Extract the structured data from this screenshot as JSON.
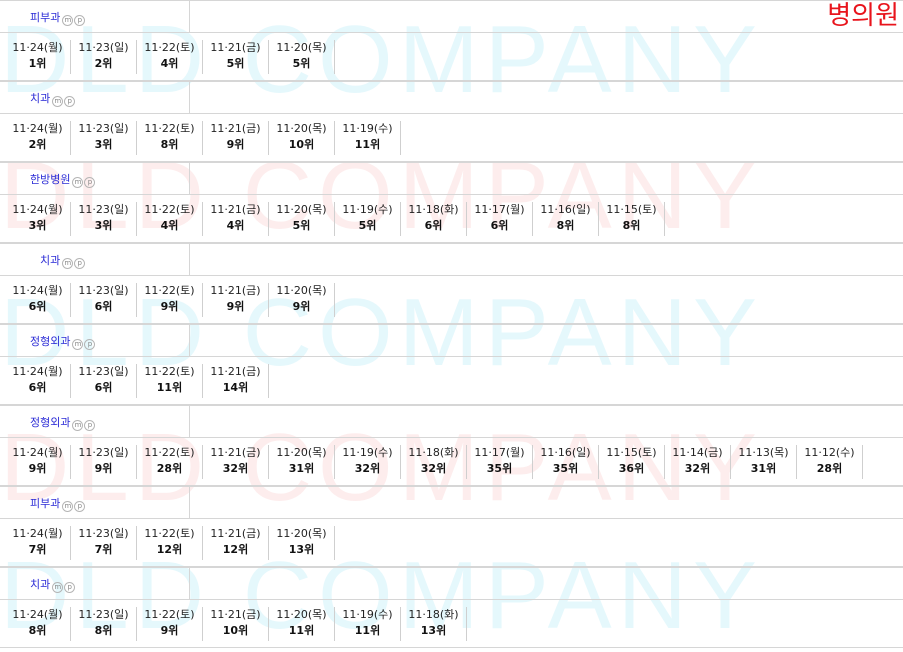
{
  "brand": "병의원",
  "watermark": "DLD COMPANY",
  "mp_icons": [
    "m",
    "p"
  ],
  "sections": [
    {
      "dept": "피부과",
      "ranks": [
        {
          "d": "11·24(월)",
          "r": "1위"
        },
        {
          "d": "11·23(일)",
          "r": "2위"
        },
        {
          "d": "11·22(토)",
          "r": "4위"
        },
        {
          "d": "11·21(금)",
          "r": "5위"
        },
        {
          "d": "11·20(목)",
          "r": "5위"
        }
      ]
    },
    {
      "dept": "치과",
      "ranks": [
        {
          "d": "11·24(월)",
          "r": "2위"
        },
        {
          "d": "11·23(일)",
          "r": "3위"
        },
        {
          "d": "11·22(토)",
          "r": "8위"
        },
        {
          "d": "11·21(금)",
          "r": "9위"
        },
        {
          "d": "11·20(목)",
          "r": "10위"
        },
        {
          "d": "11·19(수)",
          "r": "11위"
        }
      ]
    },
    {
      "dept": "한방병원",
      "ranks": [
        {
          "d": "11·24(월)",
          "r": "3위"
        },
        {
          "d": "11·23(일)",
          "r": "3위"
        },
        {
          "d": "11·22(토)",
          "r": "4위"
        },
        {
          "d": "11·21(금)",
          "r": "4위"
        },
        {
          "d": "11·20(목)",
          "r": "5위"
        },
        {
          "d": "11·19(수)",
          "r": "5위"
        },
        {
          "d": "11·18(화)",
          "r": "6위"
        },
        {
          "d": "11·17(월)",
          "r": "6위"
        },
        {
          "d": "11·16(일)",
          "r": "8위"
        },
        {
          "d": "11·15(토)",
          "r": "8위"
        }
      ]
    },
    {
      "dept": "치과",
      "ranks": [
        {
          "d": "11·24(월)",
          "r": "6위"
        },
        {
          "d": "11·23(일)",
          "r": "6위"
        },
        {
          "d": "11·22(토)",
          "r": "9위"
        },
        {
          "d": "11·21(금)",
          "r": "9위"
        },
        {
          "d": "11·20(목)",
          "r": "9위"
        }
      ]
    },
    {
      "dept": "정형외과",
      "ranks": [
        {
          "d": "11·24(월)",
          "r": "6위"
        },
        {
          "d": "11·23(일)",
          "r": "6위"
        },
        {
          "d": "11·22(토)",
          "r": "11위"
        },
        {
          "d": "11·21(금)",
          "r": "14위"
        }
      ]
    },
    {
      "dept": "정형외과",
      "ranks": [
        {
          "d": "11·24(월)",
          "r": "9위"
        },
        {
          "d": "11·23(일)",
          "r": "9위"
        },
        {
          "d": "11·22(토)",
          "r": "28위"
        },
        {
          "d": "11·21(금)",
          "r": "32위"
        },
        {
          "d": "11·20(목)",
          "r": "31위"
        },
        {
          "d": "11·19(수)",
          "r": "32위"
        },
        {
          "d": "11·18(화)",
          "r": "32위"
        },
        {
          "d": "11·17(월)",
          "r": "35위"
        },
        {
          "d": "11·16(일)",
          "r": "35위"
        },
        {
          "d": "11·15(토)",
          "r": "36위"
        },
        {
          "d": "11·14(금)",
          "r": "32위"
        },
        {
          "d": "11·13(목)",
          "r": "31위"
        },
        {
          "d": "11·12(수)",
          "r": "28위"
        }
      ]
    },
    {
      "dept": "피부과",
      "ranks": [
        {
          "d": "11·24(월)",
          "r": "7위"
        },
        {
          "d": "11·23(일)",
          "r": "7위"
        },
        {
          "d": "11·22(토)",
          "r": "12위"
        },
        {
          "d": "11·21(금)",
          "r": "12위"
        },
        {
          "d": "11·20(목)",
          "r": "13위"
        }
      ]
    },
    {
      "dept": "치과",
      "ranks": [
        {
          "d": "11·24(월)",
          "r": "8위"
        },
        {
          "d": "11·23(일)",
          "r": "8위"
        },
        {
          "d": "11·22(토)",
          "r": "9위"
        },
        {
          "d": "11·21(금)",
          "r": "10위"
        },
        {
          "d": "11·20(목)",
          "r": "11위"
        },
        {
          "d": "11·19(수)",
          "r": "11위"
        },
        {
          "d": "11·18(화)",
          "r": "13위"
        }
      ]
    }
  ]
}
